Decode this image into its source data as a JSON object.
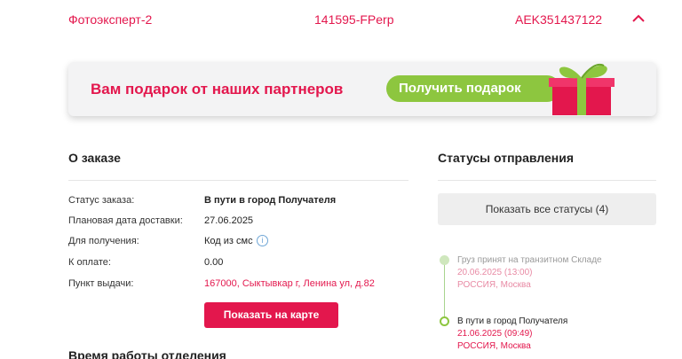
{
  "order_header": {
    "sender_name": "Фотоэксперт-2",
    "track_number": "141595-FPerp",
    "order_code": "AEK351437122",
    "expand_state": "expanded"
  },
  "gift_banner": {
    "title": "Вам подарок от наших партнеров",
    "button_label": "Получить подарок"
  },
  "about": {
    "title": "О заказе",
    "rows": [
      {
        "label": "Статус заказа:",
        "value": "В пути в город Получателя"
      },
      {
        "label": "Плановая дата доставки:",
        "value": "27.06.2025"
      },
      {
        "label": "Для получения:",
        "value": "Код из смс"
      },
      {
        "label": "К оплате:",
        "value": "0.00"
      },
      {
        "label": "Пункт выдачи:",
        "value": "167000, Сыктывкар г, Ленина ул, д.82"
      }
    ],
    "map_button_label": "Показать на карте",
    "hours_title": "Время работы отделения"
  },
  "statuses": {
    "title": "Статусы отправления",
    "all_button_label": "Показать все статусы (4)",
    "items": [
      {
        "title": "Груз принят на транзитном Складе",
        "date": "20.06.2025 (13:00)",
        "place": "РОССИЯ, Москва"
      },
      {
        "title": "В пути в город Получателя",
        "date": "21.06.2025 (09:49)",
        "place": "РОССИЯ, Москва"
      }
    ]
  },
  "colors": {
    "accent": "#e3174d",
    "gift_green": "#8dc63f",
    "timeline_green": "#a8d48e"
  }
}
